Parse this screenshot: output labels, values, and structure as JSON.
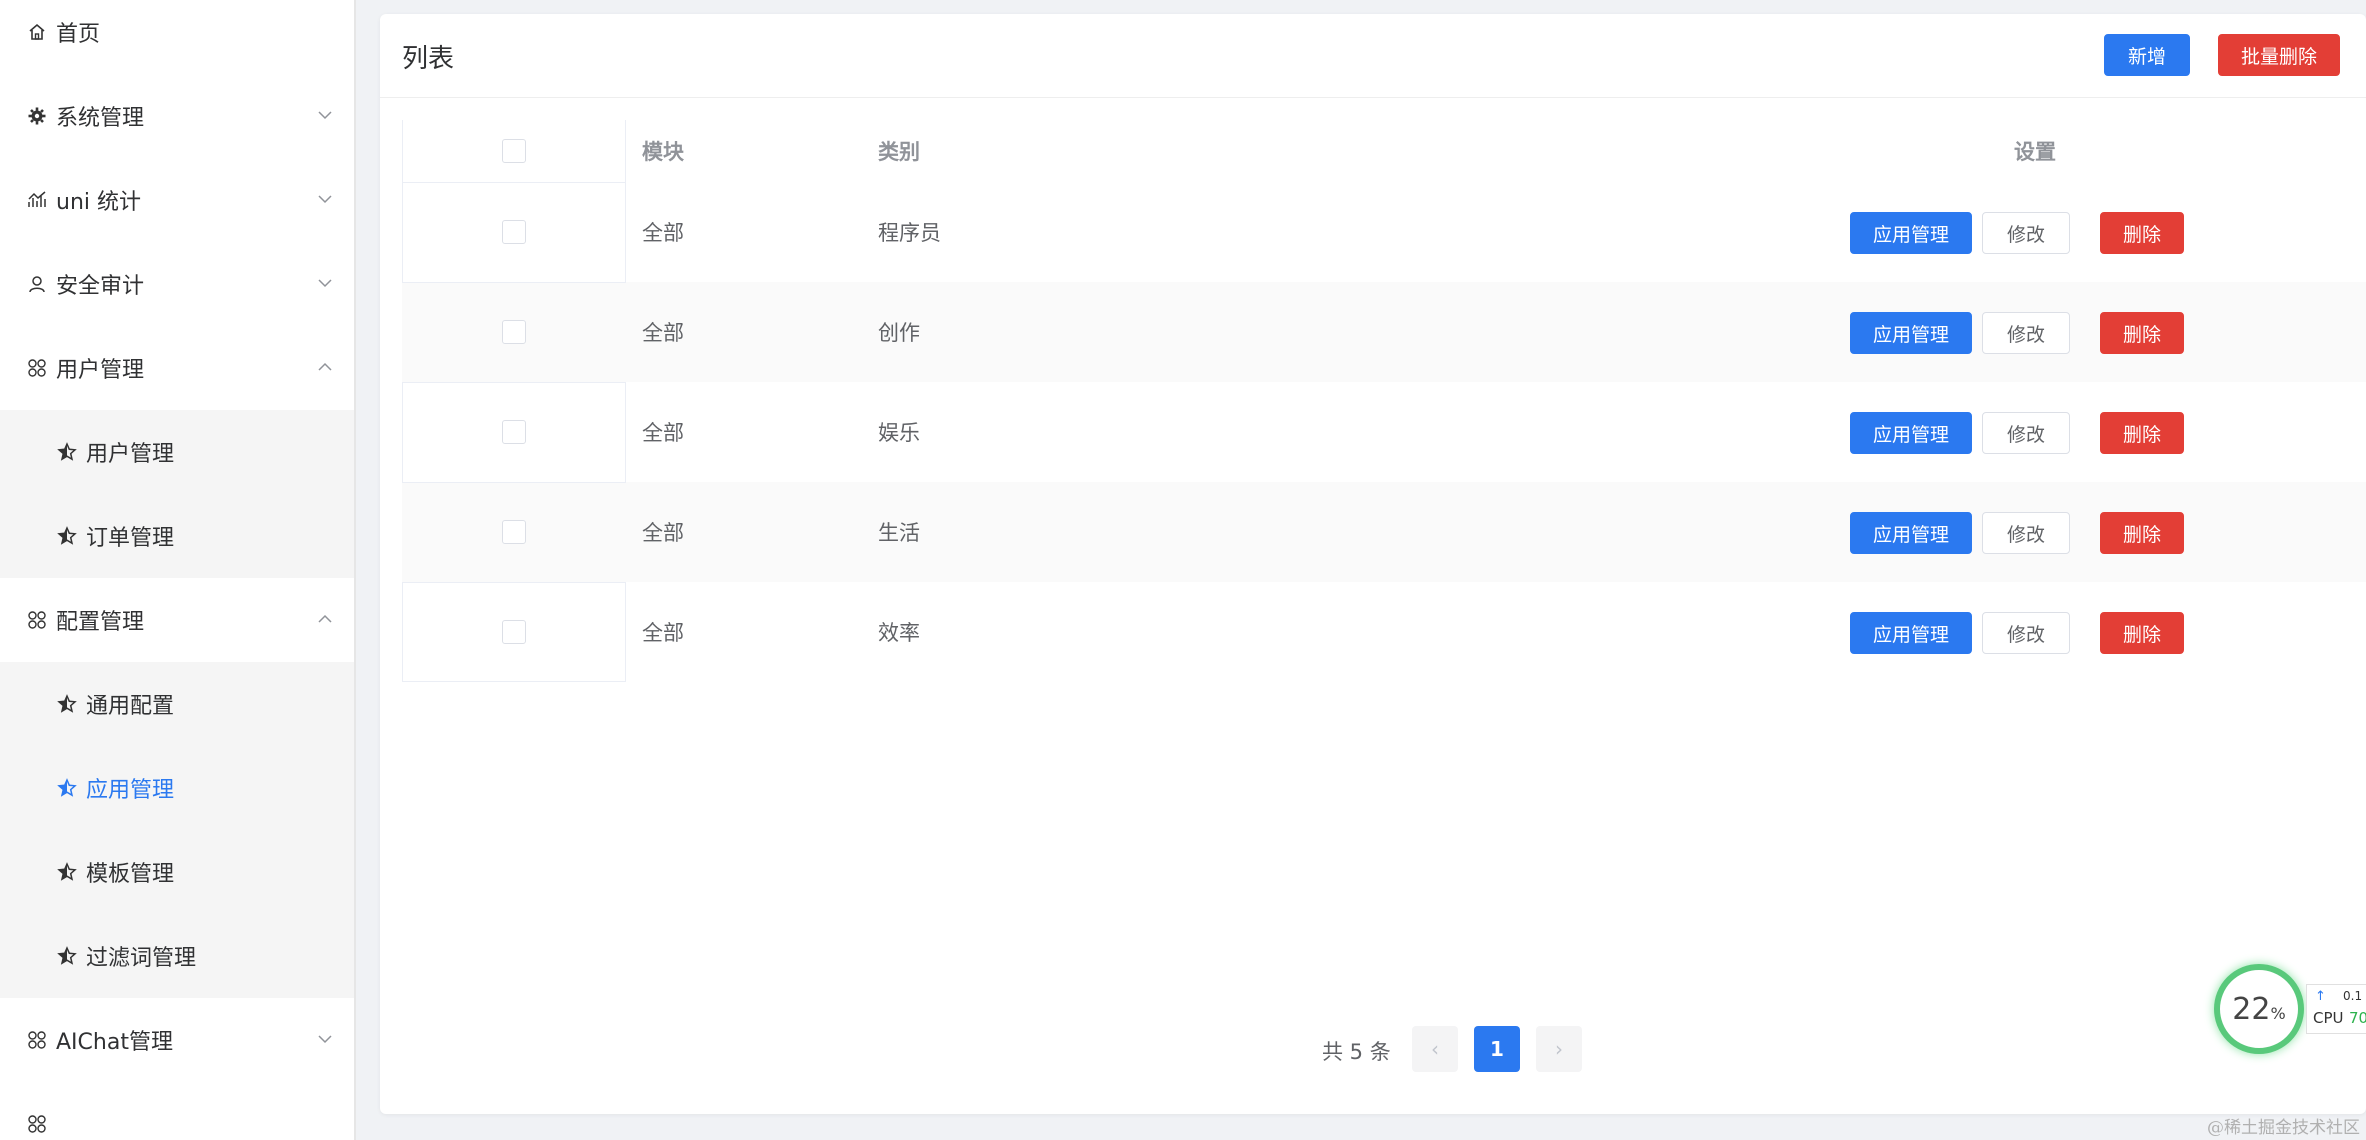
{
  "sidebar": {
    "items": [
      {
        "label": "首页",
        "icon": "home-icon",
        "chevron": ""
      },
      {
        "label": "系统管理",
        "icon": "gear-icon",
        "chevron": "down"
      },
      {
        "label": "uni 统计",
        "icon": "stats-icon",
        "chevron": "down"
      },
      {
        "label": "安全审计",
        "icon": "user-icon",
        "chevron": "down"
      },
      {
        "label": "用户管理",
        "icon": "grid-icon",
        "chevron": "up"
      },
      {
        "label": "配置管理",
        "icon": "grid-icon",
        "chevron": "up"
      },
      {
        "label": "AIChat管理",
        "icon": "grid-icon",
        "chevron": "down"
      }
    ],
    "user_subitems": [
      {
        "label": "用户管理",
        "icon": "star-icon"
      },
      {
        "label": "订单管理",
        "icon": "star-icon"
      }
    ],
    "config_subitems": [
      {
        "label": "通用配置",
        "icon": "star-icon"
      },
      {
        "label": "应用管理",
        "icon": "star-icon",
        "active": true
      },
      {
        "label": "模板管理",
        "icon": "star-icon"
      },
      {
        "label": "过滤词管理",
        "icon": "star-icon"
      }
    ]
  },
  "card": {
    "title": "列表",
    "add_label": "新增",
    "batch_delete_label": "批量删除"
  },
  "table": {
    "headers": {
      "module": "模块",
      "category": "类别",
      "settings": "设置"
    },
    "rows": [
      {
        "module": "全部",
        "category": "程序员"
      },
      {
        "module": "全部",
        "category": "创作"
      },
      {
        "module": "全部",
        "category": "娱乐"
      },
      {
        "module": "全部",
        "category": "生活"
      },
      {
        "module": "全部",
        "category": "效率"
      }
    ],
    "actions": {
      "manage": "应用管理",
      "edit": "修改",
      "delete": "删除"
    }
  },
  "pagination": {
    "total_text": "共 5 条",
    "current_page": "1",
    "prev": "‹",
    "next": "›"
  },
  "cpu_widget": {
    "percent": "22",
    "percent_sign": "%",
    "up_arrow": "↑",
    "up_value": "0.1",
    "cpu_label": "CPU",
    "cpu_value": "70"
  },
  "watermark": "@稀土掘金技术社区",
  "colors": {
    "primary": "#2b79f0",
    "danger": "#e33e36",
    "active_menu": "#2b79f0"
  }
}
